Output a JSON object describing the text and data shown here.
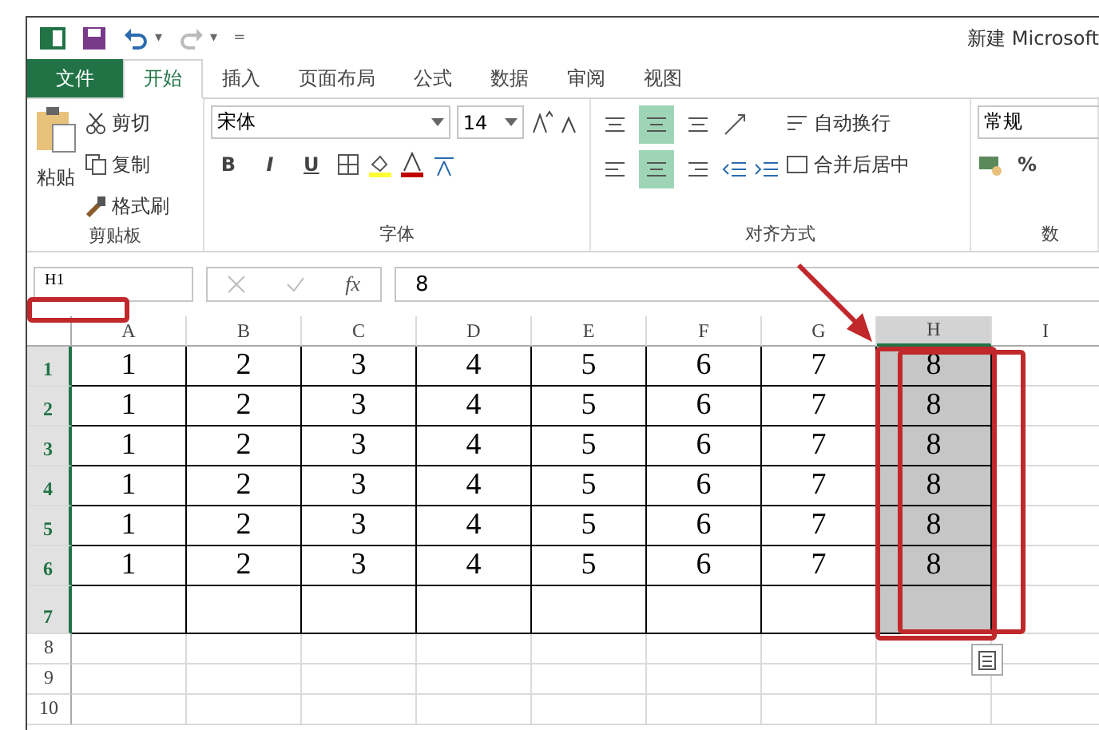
{
  "window": {
    "title": "新建 Microsoft"
  },
  "quick_access": {
    "undo_caret": "▾",
    "redo_caret": "▾",
    "customize": "="
  },
  "tabs": [
    {
      "label": "文件",
      "kind": "file",
      "selected": false
    },
    {
      "label": "开始",
      "kind": "tab",
      "selected": true
    },
    {
      "label": "插入",
      "kind": "tab",
      "selected": false
    },
    {
      "label": "页面布局",
      "kind": "tab",
      "selected": false
    },
    {
      "label": "公式",
      "kind": "tab",
      "selected": false
    },
    {
      "label": "数据",
      "kind": "tab",
      "selected": false
    },
    {
      "label": "审阅",
      "kind": "tab",
      "selected": false
    },
    {
      "label": "视图",
      "kind": "tab",
      "selected": false
    }
  ],
  "ribbon": {
    "clipboard": {
      "paste": "粘贴",
      "cut": "剪切",
      "copy": "复制",
      "format_painter": "格式刷",
      "label": "剪贴板"
    },
    "font": {
      "name": "宋体",
      "size": "14",
      "bold": "B",
      "italic": "I",
      "underline": "U",
      "label": "字体"
    },
    "alignment": {
      "middle_selected": true,
      "center_selected": true,
      "wrap": "自动换行",
      "merge": "合并后居中",
      "label": "对齐方式"
    },
    "number": {
      "format": "常规",
      "percent": "%",
      "label": "数"
    }
  },
  "formula_bar": {
    "name_box": "H1",
    "function_label": "fx",
    "value": "8"
  },
  "sheet": {
    "columns": [
      {
        "label": "A",
        "selected": false
      },
      {
        "label": "B",
        "selected": false
      },
      {
        "label": "C",
        "selected": false
      },
      {
        "label": "D",
        "selected": false
      },
      {
        "label": "E",
        "selected": false
      },
      {
        "label": "F",
        "selected": false
      },
      {
        "label": "G",
        "selected": false
      },
      {
        "label": "H",
        "selected": true
      },
      {
        "label": "I",
        "selected": false
      }
    ],
    "rows": [
      {
        "label": "1",
        "selected": true,
        "tall": false,
        "bordered": true,
        "cells": [
          "1",
          "2",
          "3",
          "4",
          "5",
          "6",
          "7",
          "8"
        ]
      },
      {
        "label": "2",
        "selected": true,
        "tall": false,
        "bordered": true,
        "cells": [
          "1",
          "2",
          "3",
          "4",
          "5",
          "6",
          "7",
          "8"
        ]
      },
      {
        "label": "3",
        "selected": true,
        "tall": false,
        "bordered": true,
        "cells": [
          "1",
          "2",
          "3",
          "4",
          "5",
          "6",
          "7",
          "8"
        ]
      },
      {
        "label": "4",
        "selected": true,
        "tall": false,
        "bordered": true,
        "cells": [
          "1",
          "2",
          "3",
          "4",
          "5",
          "6",
          "7",
          "8"
        ]
      },
      {
        "label": "5",
        "selected": true,
        "tall": false,
        "bordered": true,
        "cells": [
          "1",
          "2",
          "3",
          "4",
          "5",
          "6",
          "7",
          "8"
        ]
      },
      {
        "label": "6",
        "selected": true,
        "tall": false,
        "bordered": true,
        "cells": [
          "1",
          "2",
          "3",
          "4",
          "5",
          "6",
          "7",
          "8"
        ]
      },
      {
        "label": "7",
        "selected": true,
        "tall": true,
        "bordered": true,
        "cells": []
      },
      {
        "label": "8",
        "selected": false,
        "tall": false,
        "bordered": false,
        "cells": []
      },
      {
        "label": "9",
        "selected": false,
        "tall": false,
        "bordered": false,
        "cells": []
      },
      {
        "label": "10",
        "selected": false,
        "tall": false,
        "bordered": false,
        "cells": []
      }
    ]
  }
}
